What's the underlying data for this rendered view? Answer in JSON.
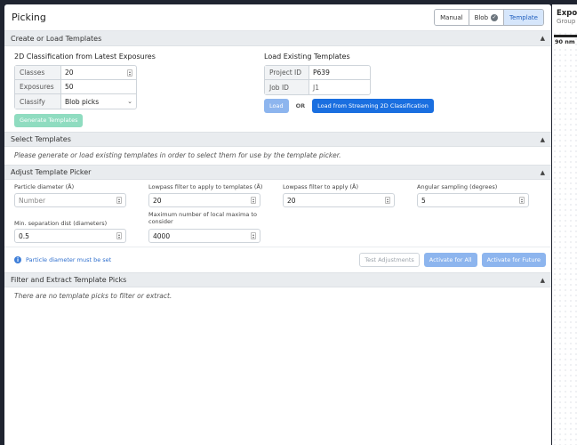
{
  "header": {
    "title": "Picking",
    "modes": [
      {
        "label": "Manual",
        "active": false
      },
      {
        "label": "Blob",
        "active": false,
        "icon": "check-circle-icon"
      },
      {
        "label": "Template",
        "active": true
      }
    ]
  },
  "sections": {
    "create": {
      "title": "Create or Load Templates",
      "left_title": "2D Classification from Latest Exposures",
      "classes_label": "Classes",
      "classes_value": "20",
      "exposures_label": "Exposures",
      "exposures_value": "50",
      "classify_label": "Classify",
      "classify_value": "Blob picks",
      "generate_button": "Generate Templates",
      "right_title": "Load Existing Templates",
      "project_label": "Project ID",
      "project_value": "P639",
      "job_label": "Job ID",
      "job_value": "J1",
      "load_button": "Load",
      "or_text": "OR",
      "stream_button": "Load from Streaming 2D Classification"
    },
    "select": {
      "title": "Select Templates",
      "note": "Please generate or load existing templates in order to select them for use by the template picker."
    },
    "adjust": {
      "title": "Adjust Template Picker",
      "particle_diameter_label": "Particle diameter (Å)",
      "particle_diameter_placeholder": "Number",
      "lowpass_templates_label": "Lowpass filter to apply to templates (Å)",
      "lowpass_templates_value": "20",
      "lowpass_label": "Lowpass filter to apply (Å)",
      "lowpass_value": "20",
      "angular_label": "Angular sampling (degrees)",
      "angular_value": "5",
      "min_sep_label": "Min. separation dist (diameters)",
      "min_sep_value": "0.5",
      "max_maxima_label": "Maximum number of local maxima to consider",
      "max_maxima_value": "4000",
      "info_text": "Particle diameter must be set",
      "test_button": "Test Adjustments",
      "activate_all_button": "Activate for All",
      "activate_future_button": "Activate for Future"
    },
    "filter": {
      "title": "Filter and Extract Template Picks",
      "note": "There are no template picks to filter or extract."
    }
  },
  "right_panel": {
    "title": "Exposures",
    "subtitle": "Group",
    "scale_label": "90 nm"
  },
  "colors": {
    "accent": "#1a6fe0",
    "success_light": "#8fdcc0",
    "background": "#1f2430"
  }
}
